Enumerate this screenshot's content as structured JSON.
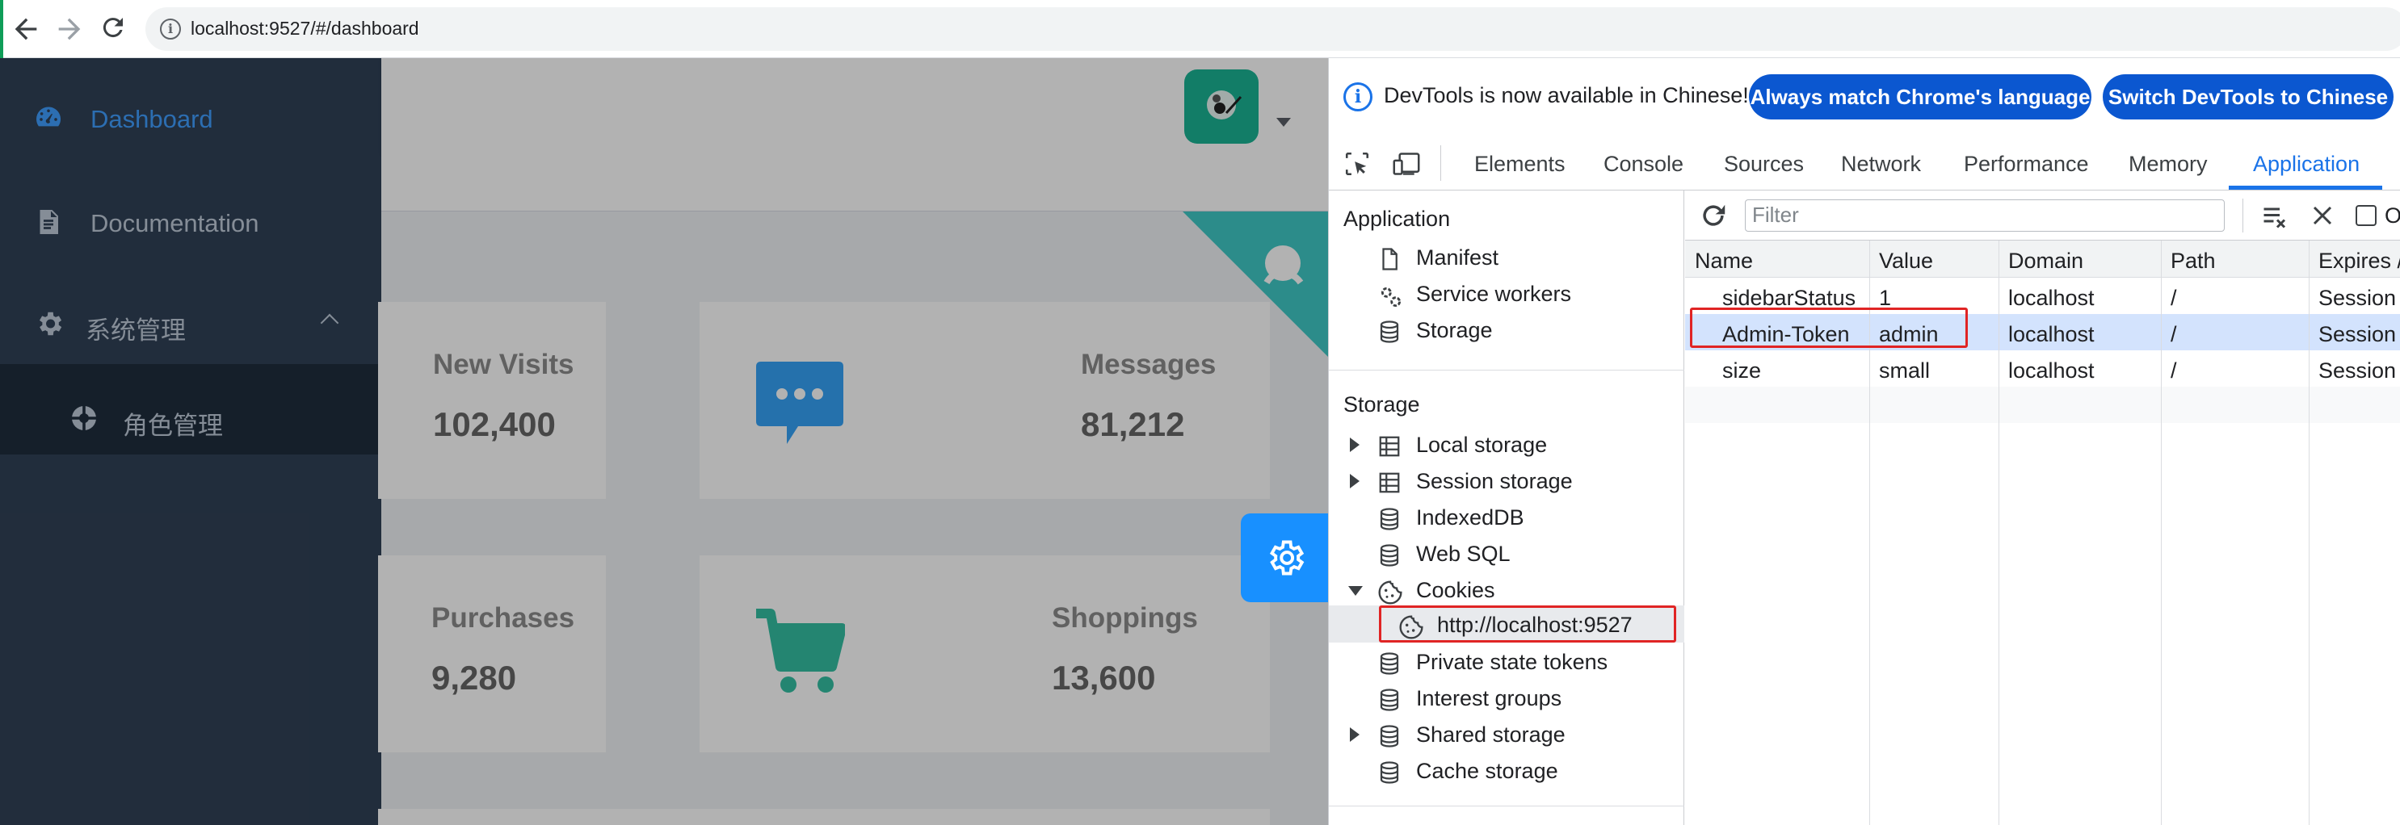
{
  "browser": {
    "url": "localhost:9527/#/dashboard",
    "icons": [
      "back-icon",
      "forward-icon",
      "reload-icon",
      "site-info-icon"
    ]
  },
  "sidebar": {
    "items": [
      {
        "label": "Dashboard",
        "icon": "dashboard-icon",
        "active": true
      },
      {
        "label": "Documentation",
        "icon": "document-icon"
      },
      {
        "label": "系统管理",
        "icon": "gear-icon",
        "expanded": true
      },
      {
        "label": "角色管理",
        "icon": "role-icon"
      }
    ]
  },
  "panels": [
    {
      "title": "New Visits",
      "value": "102,400"
    },
    {
      "title": "Messages",
      "value": "81,212",
      "icon": "message-icon",
      "color": "#40c9c6"
    },
    {
      "title": "Purchases",
      "value": "9,280"
    },
    {
      "title": "Shoppings",
      "value": "13,600",
      "icon": "shopping-cart-icon",
      "color": "#34bfa3"
    }
  ],
  "devtools": {
    "banner": {
      "message": "DevTools is now available in Chinese!",
      "btn_match": "Always match Chrome's language",
      "btn_switch": "Switch DevTools to Chinese"
    },
    "tabs": [
      "Elements",
      "Console",
      "Sources",
      "Network",
      "Performance",
      "Memory",
      "Application"
    ],
    "active_tab": "Application",
    "left": {
      "application_header": "Application",
      "application_items": [
        "Manifest",
        "Service workers",
        "Storage"
      ],
      "storage_header": "Storage",
      "storage_items": [
        "Local storage",
        "Session storage",
        "IndexedDB",
        "Web SQL",
        "Cookies",
        "http://localhost:9527",
        "Private state tokens",
        "Interest groups",
        "Shared storage",
        "Cache storage"
      ]
    },
    "filter_placeholder": "Filter",
    "columns": [
      "Name",
      "Value",
      "Domain",
      "Path",
      "Expires /"
    ],
    "rows": [
      {
        "name": "sidebarStatus",
        "value": "1",
        "domain": "localhost",
        "path": "/",
        "expires": "Session"
      },
      {
        "name": "Admin-Token",
        "value": "admin",
        "domain": "localhost",
        "path": "/",
        "expires": "Session"
      },
      {
        "name": "size",
        "value": "small",
        "domain": "localhost",
        "path": "/",
        "expires": "Session"
      }
    ],
    "checkbox_label": "O",
    "highlight_color": "#e02424"
  }
}
